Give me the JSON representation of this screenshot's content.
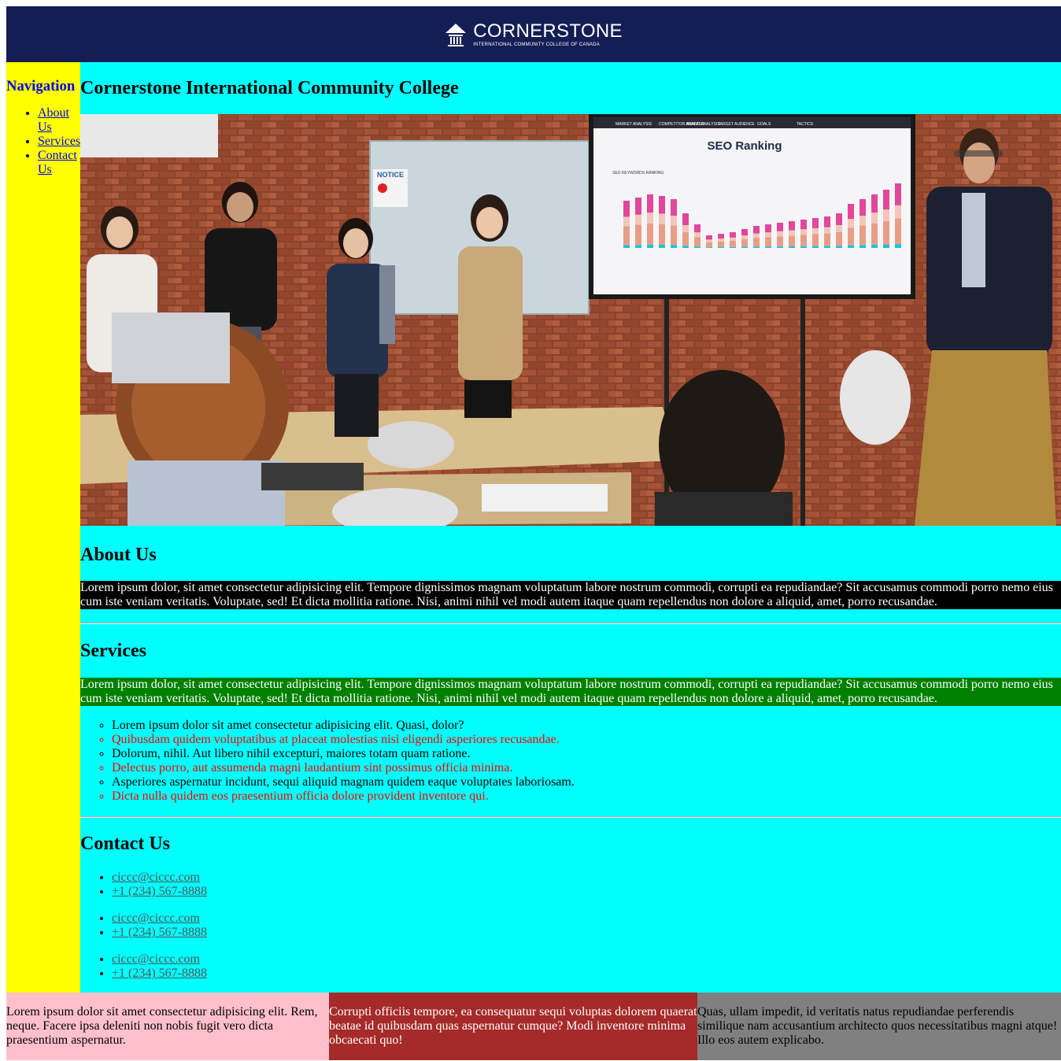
{
  "header": {
    "logo_name": "CORNERSTONE",
    "logo_subtitle": "INTERNATIONAL COMMUNITY COLLEGE OF CANADA",
    "background": "#141e54"
  },
  "sidebar": {
    "title": "Navigation",
    "items": [
      {
        "label": "About Us"
      },
      {
        "label": "Services"
      },
      {
        "label": "Contact Us"
      }
    ]
  },
  "main": {
    "title": "Cornerstone International Community College",
    "hero": {
      "slide_title": "SEO Ranking",
      "slide_tabs": [
        "MARKET ANALYSIS",
        "COMPETITOR ANALYSIS",
        "BRAND ANALYSIS",
        "TARGET AUDIENCE",
        "GOALS",
        "TACTICS"
      ],
      "slide_chart_label": "SEO KEYWORDS RANKING",
      "notice_label": "NOTICE"
    },
    "about": {
      "heading": "About Us",
      "text": "Lorem ipsum dolor, sit amet consectetur adipisicing elit. Tempore dignissimos magnam voluptatum labore nostrum commodi, corrupti ea repudiandae? Sit accusamus commodi porro nemo eius cum iste veniam veritatis. Voluptate, sed! Et dicta mollitia ratione. Nisi, animi nihil vel modi autem itaque quam repellendus non dolore a aliquid, amet, porro recusandae."
    },
    "services": {
      "heading": "Services",
      "text": "Lorem ipsum dolor, sit amet consectetur adipisicing elit. Tempore dignissimos magnam voluptatum labore nostrum commodi, corrupti ea repudiandae? Sit accusamus commodi porro nemo eius cum iste veniam veritatis. Voluptate, sed! Et dicta mollitia ratione. Nisi, animi nihil vel modi autem itaque quam repellendus non dolore a aliquid, amet, porro recusandae.",
      "items": [
        "Lorem ipsum dolor sit amet consectetur adipisicing elit. Quasi, dolor?",
        "Quibusdam quidem voluptatibus at placeat molestias nisi eligendi asperiores recusandae.",
        "Dolorum, nihil. Aut libero nihil excepturi, maiores totam quam ratione.",
        "Delectus porro, aut assumenda magni laudantium sint possimus officia minima.",
        "Asperiores aspernatur incidunt, sequi aliquid magnam quidem eaque voluptates laboriosam.",
        "Dicta nulla quidem eos praesentium officia dolore provident inventore qui."
      ]
    },
    "contact": {
      "heading": "Contact Us",
      "groups": [
        {
          "email": "ciccc@ciccc.com",
          "phone": "+1 (234) 567-8888"
        },
        {
          "email": "ciccc@ciccc.com",
          "phone": "+1 (234) 567-8888"
        },
        {
          "email": "ciccc@ciccc.com",
          "phone": "+1 (234) 567-8888"
        }
      ]
    }
  },
  "footer": {
    "col1": "Lorem ipsum dolor sit amet consectetur adipisicing elit. Rem, neque. Facere ipsa deleniti non nobis fugit vero dicta praesentium aspernatur.",
    "col2": "Corrupti officiis tempore, ea consequatur sequi voluptas dolorem quaerat beatae id quibusdam quas aspernatur cumque? Modi inventore minima obcaecati quo!",
    "col3": "Quas, ullam impedit, id veritatis natus repudiandae perferendis similique nam accusantium architecto quos necessitatibus magni atque! Illo eos autem explicabo."
  },
  "colors": {
    "sidebar": "#ffff00",
    "main": "#00ffff",
    "about_para": "#000000",
    "services_para": "#008000",
    "footer_col1": "#ffc0cb",
    "footer_col2": "#a52a2a",
    "footer_col3": "#808080"
  }
}
